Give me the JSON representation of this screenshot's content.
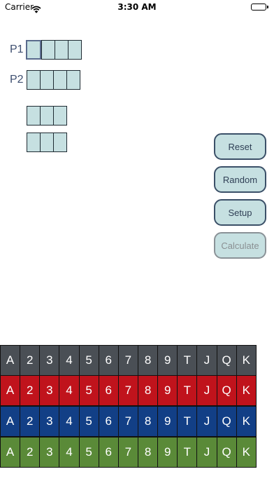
{
  "status_bar": {
    "carrier": "Carrier",
    "time": "3:30 AM"
  },
  "players": [
    {
      "label": "P1",
      "slots": 4,
      "selected": 0
    },
    {
      "label": "P2",
      "slots": 4,
      "selected": -1
    }
  ],
  "board": [
    {
      "slots": 3
    },
    {
      "slots": 3
    }
  ],
  "buttons": {
    "reset": "Reset",
    "random": "Random",
    "setup": "Setup",
    "calculate": "Calculate"
  },
  "card_ranks": [
    "A",
    "2",
    "3",
    "4",
    "5",
    "6",
    "7",
    "8",
    "9",
    "T",
    "J",
    "Q",
    "K"
  ],
  "suit_rows": [
    {
      "suit": "spades",
      "color": "#4a4f55"
    },
    {
      "suit": "hearts",
      "color": "#c0131c"
    },
    {
      "suit": "diamonds",
      "color": "#123f86"
    },
    {
      "suit": "clubs",
      "color": "#5a8a38"
    }
  ]
}
